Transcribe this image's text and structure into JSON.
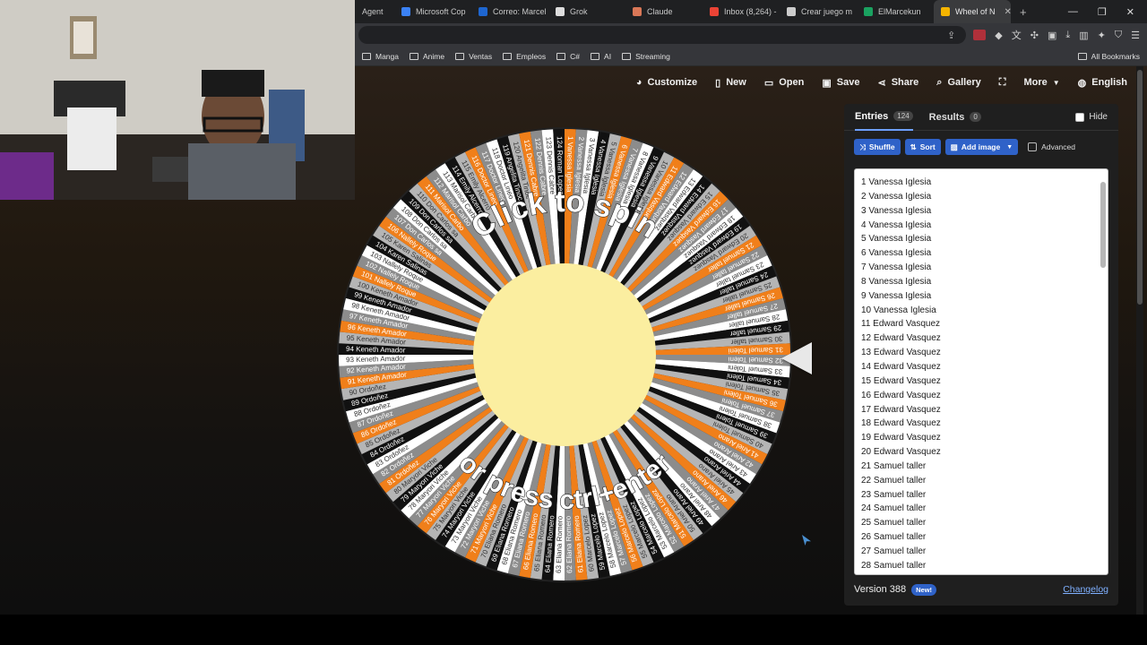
{
  "browser": {
    "tabs": [
      {
        "label": "Agent",
        "color": "#777777"
      },
      {
        "label": "Microsoft Cop",
        "color": "#3b82f6"
      },
      {
        "label": "Correo: Marcel",
        "color": "#1e66d0"
      },
      {
        "label": "Grok",
        "color": "#dddddd"
      },
      {
        "label": "Claude",
        "color": "#d97757"
      },
      {
        "label": "Inbox (8,264) -",
        "color": "#ea4335"
      },
      {
        "label": "Crear juego m",
        "color": "#cccccc"
      },
      {
        "label": "ElMarcekun",
        "color": "#1aa260"
      },
      {
        "label": "Wheel of N",
        "color": "#f5b400",
        "active": true
      }
    ],
    "new_tab": "+",
    "window_controls": [
      "—",
      "❐",
      "✕"
    ],
    "bookmarks": [
      "Manga",
      "Anime",
      "Ventas",
      "Empleos",
      "C#",
      "AI",
      "Streaming"
    ],
    "all_bookmarks": "All Bookmarks"
  },
  "nav": {
    "customize": "Customize",
    "new": "New",
    "open": "Open",
    "save": "Save",
    "share": "Share",
    "gallery": "Gallery",
    "more": "More",
    "language": "English"
  },
  "wheel": {
    "top_text": "Click to spin",
    "bottom_text": "or press ctrl+enter",
    "colors": [
      "#f07f1a",
      "#8c8c8c",
      "#ffffff",
      "#111111",
      "#b5b5b5"
    ],
    "center_color": "#fbeea0",
    "names": [
      "Vanessa Iglesia",
      "Vanessa Iglesia",
      "Vanessa Iglesia",
      "Vanessa Iglesia",
      "Vanessa Iglesia",
      "Vanessa Iglesia",
      "Vanessa Iglesia",
      "Vanessa Iglesia",
      "Vanessa Iglesia",
      "Vanessa Iglesia",
      "Edward Vasquez",
      "Edward Vasquez",
      "Edward Vasquez",
      "Edward Vasquez",
      "Edward Vasquez",
      "Edward Vasquez",
      "Edward Vasquez",
      "Edward Vasquez",
      "Edward Vasquez",
      "Edward Vasquez",
      "Samuel taller",
      "Samuel taller",
      "Samuel taller",
      "Samuel taller",
      "Samuel taller",
      "Samuel taller",
      "Samuel taller",
      "Samuel taller",
      "Samuel taller",
      "Samuel taller",
      "Samuel Toleni",
      "Samuel Toleni",
      "Samuel Toleni",
      "Samuel Toleni",
      "Samuel Toleni",
      "Samuel Toleni",
      "Samuel Toleni",
      "Samuel Toleni",
      "Samuel Toleni",
      "Samuel Toleni",
      "Ariel Arano",
      "Ariel Arano",
      "Ariel Arano",
      "Ariel Arano",
      "Ariel Arano",
      "Ariel Arano",
      "Ariel Arano",
      "Ariel Arano",
      "Ariel Arano",
      "Ariel Arano",
      "Marcelo Lopez",
      "Marcelo Lopez",
      "Marcelo Lopez",
      "Marcelo Lopez",
      "Marcelo Lopez",
      "Marcelo Lopez",
      "Marcelo Lopez",
      "Marcelo Lopez",
      "Marcelo Lopez",
      "Marcelo Lopez",
      "Eliana Romero",
      "Eliana Romero",
      "Eliana Romero",
      "Eliana Romero",
      "Eliana Romero",
      "Eliana Romero",
      "Eliana Romero",
      "Eliana Romero",
      "Eliana Romero",
      "Eliana Romero",
      "Maryori Viche",
      "Maryori Viche",
      "Maryori Viche",
      "Maryori Viche",
      "Maryori Viche",
      "Maryori Viche",
      "Maryori Viche",
      "Maryori Viche",
      "Maryori Viche",
      "Maryori Viche",
      "Ordoñez",
      "Ordoñez",
      "Ordoñez",
      "Ordoñez",
      "Ordoñez",
      "Ordoñez",
      "Ordoñez",
      "Ordoñez",
      "Ordoñez",
      "Ordoñez",
      "Keneth Amador",
      "Keneth Amador",
      "Keneth Amador",
      "Keneth Amador",
      "Keneth Amador",
      "Keneth Amador",
      "Keneth Amador",
      "Keneth Amador",
      "Keneth Amador",
      "Keneth Amador",
      "Nallely Roque",
      "Nallely Roque",
      "Nallely Roque",
      "Karen Salinas",
      "Karen Salinas",
      "Nallely Roque",
      "Don Carlos sa",
      "Don Carlos sa",
      "Don Carlos sa",
      "Don Carlos sa",
      "Marisol Carbo",
      "Marisol Carbo",
      "Marisol Carbo",
      "Emily Alcerro",
      "Emily Alcerro",
      "Doctor Lineo",
      "Doctor Lineo",
      "Doctor Lineo",
      "Angelita Tinoc",
      "Angelita Tinoc",
      "Dennis Cabre",
      "Dennis Cabre",
      "Dennis Cabre",
      "Roman Lopez"
    ]
  },
  "sidebar": {
    "tab_entries": "Entries",
    "entries_count": "124",
    "tab_results": "Results",
    "results_count": "0",
    "hide": "Hide",
    "shuffle": "Shuffle",
    "sort": "Sort",
    "add_image": "Add image",
    "advanced": "Advanced",
    "entries": [
      "1 Vanessa Iglesia",
      "2 Vanessa Iglesia",
      "3 Vanessa Iglesia",
      "4 Vanessa Iglesia",
      "5 Vanessa Iglesia",
      "6 Vanessa Iglesia",
      "7 Vanessa Iglesia",
      "8 Vanessa Iglesia",
      "9 Vanessa Iglesia",
      "10 Vanessa Iglesia",
      "11 Edward Vasquez",
      "12 Edward Vasquez",
      "13 Edward Vasquez",
      "14 Edward Vasquez",
      "15 Edward Vasquez",
      "16 Edward Vasquez",
      "17 Edward Vasquez",
      "18 Edward Vasquez",
      "19 Edward Vasquez",
      "20 Edward Vasquez",
      "21 Samuel taller",
      "22 Samuel taller",
      "23 Samuel taller",
      "24 Samuel taller",
      "25 Samuel taller",
      "26 Samuel taller",
      "27 Samuel taller",
      "28 Samuel taller"
    ],
    "version": "Version 388",
    "new_badge": "New!",
    "changelog": "Changelog"
  }
}
